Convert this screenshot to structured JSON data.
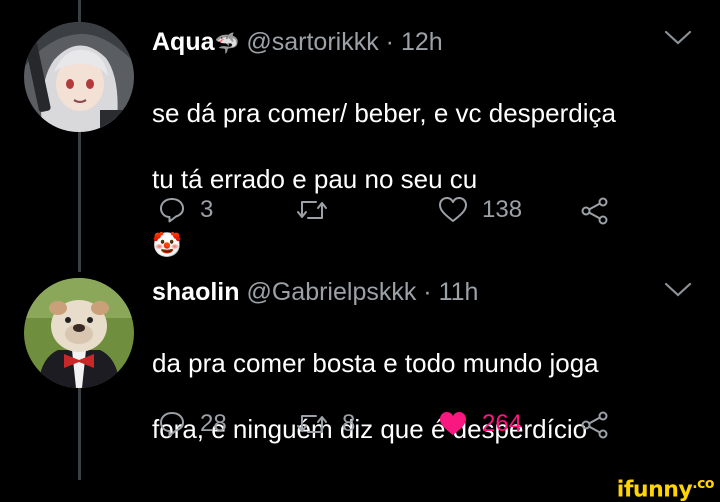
{
  "tweets": [
    {
      "name": "Aqua",
      "name_emoji": "🦈",
      "handle": "@sartorikkk",
      "dot": "·",
      "time": "12h",
      "text_line1": "se dá pra comer/ beber, e vc desperdiça",
      "text_line2": "tu tá errado e pau no seu cu",
      "text_emoji": "🤡",
      "replies": "3",
      "retweets": "",
      "likes": "138",
      "liked": false
    },
    {
      "name": "shaolin",
      "handle": "@Gabrielpskkk",
      "dot": "·",
      "time": "11h",
      "text_line1": "da pra comer bosta e todo mundo joga",
      "text_line2": "fora, e ninguém diz que é desperdício",
      "replies": "28",
      "retweets": "8",
      "likes": "264",
      "liked": true
    }
  ],
  "watermark": {
    "text": "ifunny",
    "suffix": ".co"
  },
  "colors": {
    "background": "#000000",
    "muted": "#9ba1a6",
    "like": "#f91880",
    "watermark": "#ffd400"
  }
}
